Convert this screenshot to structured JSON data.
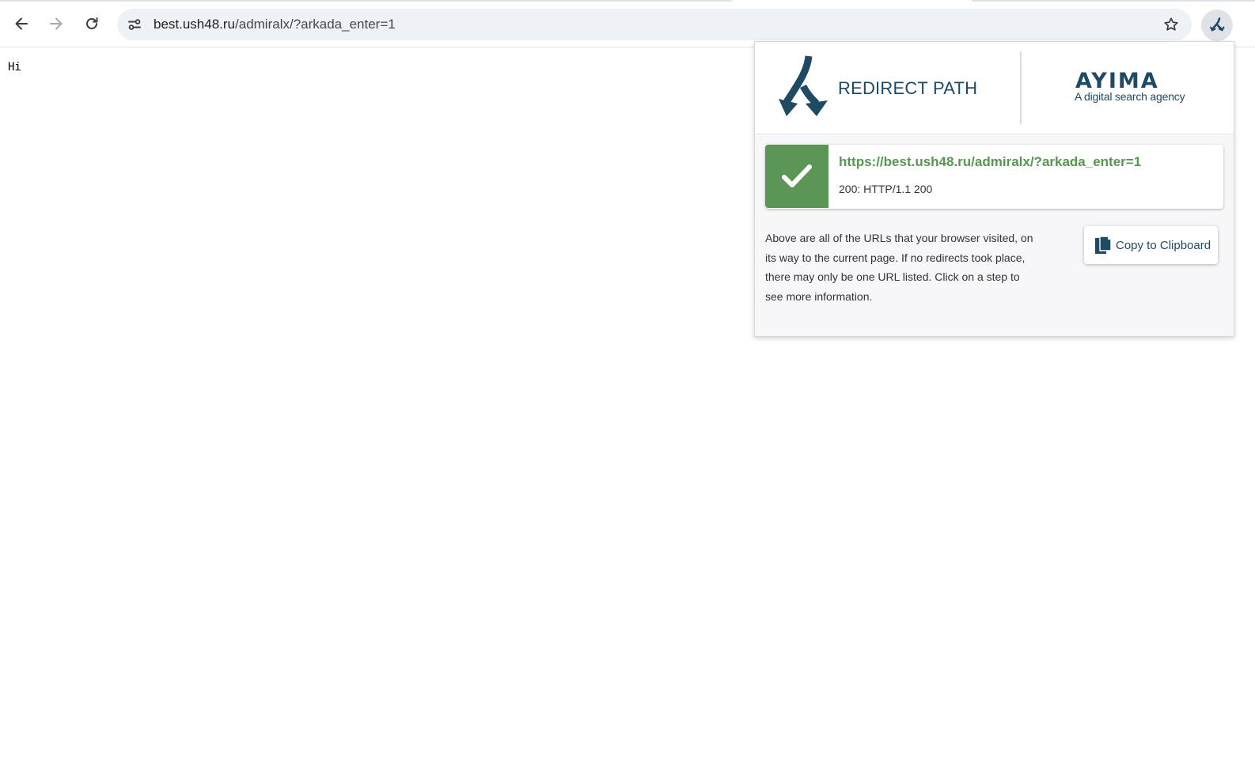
{
  "browser": {
    "url_host": "best.ush48.ru",
    "url_path": "/admiralx/?arkada_enter=1",
    "icons": {
      "back": "back-arrow-icon",
      "forward": "forward-arrow-icon",
      "reload": "reload-icon",
      "site_info": "site-settings-icon",
      "bookmark": "star-icon",
      "extension": "redirect-path-icon"
    }
  },
  "page": {
    "text": "Hi"
  },
  "popup": {
    "header": {
      "product_name": "REDIRECT PATH",
      "partner_logo": "AYIMA",
      "partner_tagline": "A digital search agency"
    },
    "results": [
      {
        "url": "https://best.ush48.ru/admiralx/?arkada_enter=1",
        "status": "200: HTTP/1.1 200",
        "status_color": "#5c9657"
      }
    ],
    "info_text": "Above are all of the URLs that your browser visited, on its way to the current page. If no redirects took place, there may only be one URL listed. Click on a step to see more information.",
    "copy_button_label": "Copy to Clipboard"
  },
  "colors": {
    "brand": "#1e4b63",
    "success": "#5c9657",
    "success_text": "#57964f"
  }
}
